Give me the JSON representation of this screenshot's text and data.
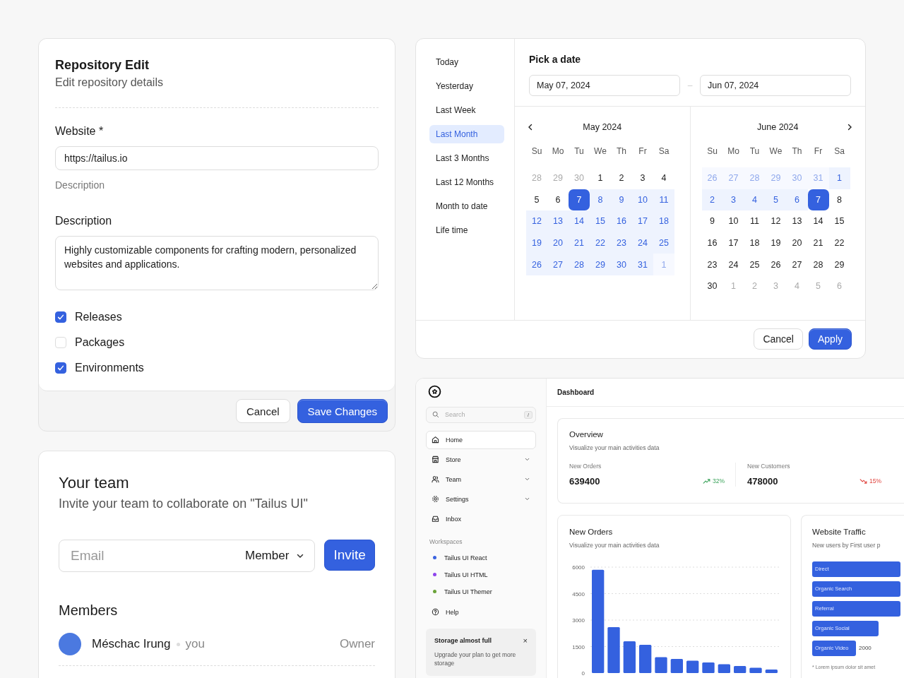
{
  "repository_card": {
    "title": "Repository Edit",
    "subtitle": "Edit repository details",
    "website_label": "Website *",
    "website_value": "https://tailus.io",
    "website_help": "Description",
    "description_label": "Description",
    "description_value": "Highly customizable components for crafting modern, personalized websites and applications.",
    "options": [
      {
        "label": "Releases",
        "checked": true
      },
      {
        "label": "Packages",
        "checked": false
      },
      {
        "label": "Environments",
        "checked": true
      }
    ],
    "buttons": [
      {
        "label": "Cancel",
        "kind": "secondary"
      },
      {
        "label": "Save Changes",
        "kind": "primary"
      }
    ]
  },
  "team_card": {
    "title": "Your team",
    "subtitle": "Invite your team to collaborate on \"Tailus UI\"",
    "email_placeholder": "Email",
    "role": "Member",
    "invite_button": "Invite",
    "members_title": "Members",
    "members": [
      {
        "name": "Méschac Irung",
        "tag": "you",
        "role": "Owner"
      }
    ]
  },
  "date_picker": {
    "presets": [
      {
        "label": "Today",
        "selected": false
      },
      {
        "label": "Yesterday",
        "selected": false
      },
      {
        "label": "Last Week",
        "selected": false
      },
      {
        "label": "Last Month",
        "selected": true
      },
      {
        "label": "Last 3 Months",
        "selected": false
      },
      {
        "label": "Last 12 Months",
        "selected": false
      },
      {
        "label": "Month to date",
        "selected": false
      },
      {
        "label": "Life time",
        "selected": false
      }
    ],
    "title": "Pick a date",
    "start_date": "May 07, 2024",
    "range_separator": "–",
    "end_date": "Jun 07, 2024",
    "months": [
      {
        "title": "May 2024",
        "weekdays": [
          "Su",
          "Mo",
          "Tu",
          "We",
          "Th",
          "Fr",
          "Sa"
        ],
        "days": [
          {
            "n": "28",
            "kind": "outside",
            "in_range": false,
            "selected": false
          },
          {
            "n": "29",
            "kind": "outside",
            "in_range": false,
            "selected": false
          },
          {
            "n": "30",
            "kind": "outside",
            "in_range": false,
            "selected": false
          },
          {
            "n": "1",
            "kind": "day",
            "in_range": false,
            "selected": false
          },
          {
            "n": "2",
            "kind": "day",
            "in_range": false,
            "selected": false
          },
          {
            "n": "3",
            "kind": "day",
            "in_range": false,
            "selected": false
          },
          {
            "n": "4",
            "kind": "day",
            "in_range": false,
            "selected": false
          },
          {
            "n": "5",
            "kind": "day",
            "in_range": false,
            "selected": false
          },
          {
            "n": "6",
            "kind": "day",
            "in_range": false,
            "selected": false
          },
          {
            "n": "7",
            "kind": "day",
            "in_range": true,
            "selected": true
          },
          {
            "n": "8",
            "kind": "day",
            "in_range": true,
            "selected": false
          },
          {
            "n": "9",
            "kind": "day",
            "in_range": true,
            "selected": false
          },
          {
            "n": "10",
            "kind": "day",
            "in_range": true,
            "selected": false
          },
          {
            "n": "11",
            "kind": "day",
            "in_range": true,
            "selected": false
          },
          {
            "n": "12",
            "kind": "day",
            "in_range": true,
            "selected": false
          },
          {
            "n": "13",
            "kind": "day",
            "in_range": true,
            "selected": false
          },
          {
            "n": "14",
            "kind": "day",
            "in_range": true,
            "selected": false
          },
          {
            "n": "15",
            "kind": "day",
            "in_range": true,
            "selected": false
          },
          {
            "n": "16",
            "kind": "day",
            "in_range": true,
            "selected": false
          },
          {
            "n": "17",
            "kind": "day",
            "in_range": true,
            "selected": false
          },
          {
            "n": "18",
            "kind": "day",
            "in_range": true,
            "selected": false
          },
          {
            "n": "19",
            "kind": "day",
            "in_range": true,
            "selected": false
          },
          {
            "n": "20",
            "kind": "day",
            "in_range": true,
            "selected": false
          },
          {
            "n": "21",
            "kind": "day",
            "in_range": true,
            "selected": false
          },
          {
            "n": "22",
            "kind": "day",
            "in_range": true,
            "selected": false
          },
          {
            "n": "23",
            "kind": "day",
            "in_range": true,
            "selected": false
          },
          {
            "n": "24",
            "kind": "day",
            "in_range": true,
            "selected": false
          },
          {
            "n": "25",
            "kind": "day",
            "in_range": true,
            "selected": false
          },
          {
            "n": "26",
            "kind": "day",
            "in_range": true,
            "selected": false
          },
          {
            "n": "27",
            "kind": "day",
            "in_range": true,
            "selected": false
          },
          {
            "n": "28",
            "kind": "day",
            "in_range": true,
            "selected": false
          },
          {
            "n": "29",
            "kind": "day",
            "in_range": true,
            "selected": false
          },
          {
            "n": "30",
            "kind": "day",
            "in_range": true,
            "selected": false
          },
          {
            "n": "31",
            "kind": "day",
            "in_range": true,
            "selected": false
          },
          {
            "n": "1",
            "kind": "outside",
            "in_range": true,
            "selected": false
          }
        ]
      },
      {
        "title": "June 2024",
        "weekdays": [
          "Su",
          "Mo",
          "Tu",
          "We",
          "Th",
          "Fr",
          "Sa"
        ],
        "days": [
          {
            "n": "26",
            "kind": "outside",
            "in_range": true,
            "selected": false
          },
          {
            "n": "27",
            "kind": "outside",
            "in_range": true,
            "selected": false
          },
          {
            "n": "28",
            "kind": "outside",
            "in_range": true,
            "selected": false
          },
          {
            "n": "29",
            "kind": "outside",
            "in_range": true,
            "selected": false
          },
          {
            "n": "30",
            "kind": "outside",
            "in_range": true,
            "selected": false
          },
          {
            "n": "31",
            "kind": "outside",
            "in_range": true,
            "selected": false
          },
          {
            "n": "1",
            "kind": "day",
            "in_range": true,
            "selected": false
          },
          {
            "n": "2",
            "kind": "day",
            "in_range": true,
            "selected": false
          },
          {
            "n": "3",
            "kind": "day",
            "in_range": true,
            "selected": false
          },
          {
            "n": "4",
            "kind": "day",
            "in_range": true,
            "selected": false
          },
          {
            "n": "5",
            "kind": "day",
            "in_range": true,
            "selected": false
          },
          {
            "n": "6",
            "kind": "day",
            "in_range": true,
            "selected": false
          },
          {
            "n": "7",
            "kind": "day",
            "in_range": true,
            "selected": true
          },
          {
            "n": "8",
            "kind": "day",
            "in_range": false,
            "selected": false
          },
          {
            "n": "9",
            "kind": "day",
            "in_range": false,
            "selected": false
          },
          {
            "n": "10",
            "kind": "day",
            "in_range": false,
            "selected": false
          },
          {
            "n": "11",
            "kind": "day",
            "in_range": false,
            "selected": false
          },
          {
            "n": "12",
            "kind": "day",
            "in_range": false,
            "selected": false
          },
          {
            "n": "13",
            "kind": "day",
            "in_range": false,
            "selected": false
          },
          {
            "n": "14",
            "kind": "day",
            "in_range": false,
            "selected": false
          },
          {
            "n": "15",
            "kind": "day",
            "in_range": false,
            "selected": false
          },
          {
            "n": "16",
            "kind": "day",
            "in_range": false,
            "selected": false
          },
          {
            "n": "17",
            "kind": "day",
            "in_range": false,
            "selected": false
          },
          {
            "n": "18",
            "kind": "day",
            "in_range": false,
            "selected": false
          },
          {
            "n": "19",
            "kind": "day",
            "in_range": false,
            "selected": false
          },
          {
            "n": "20",
            "kind": "day",
            "in_range": false,
            "selected": false
          },
          {
            "n": "21",
            "kind": "day",
            "in_range": false,
            "selected": false
          },
          {
            "n": "22",
            "kind": "day",
            "in_range": false,
            "selected": false
          },
          {
            "n": "23",
            "kind": "day",
            "in_range": false,
            "selected": false
          },
          {
            "n": "24",
            "kind": "day",
            "in_range": false,
            "selected": false
          },
          {
            "n": "25",
            "kind": "day",
            "in_range": false,
            "selected": false
          },
          {
            "n": "26",
            "kind": "day",
            "in_range": false,
            "selected": false
          },
          {
            "n": "27",
            "kind": "day",
            "in_range": false,
            "selected": false
          },
          {
            "n": "28",
            "kind": "day",
            "in_range": false,
            "selected": false
          },
          {
            "n": "29",
            "kind": "day",
            "in_range": false,
            "selected": false
          },
          {
            "n": "30",
            "kind": "day",
            "in_range": false,
            "selected": false
          },
          {
            "n": "1",
            "kind": "outside",
            "in_range": false,
            "selected": false
          },
          {
            "n": "2",
            "kind": "outside",
            "in_range": false,
            "selected": false
          },
          {
            "n": "3",
            "kind": "outside",
            "in_range": false,
            "selected": false
          },
          {
            "n": "4",
            "kind": "outside",
            "in_range": false,
            "selected": false
          },
          {
            "n": "5",
            "kind": "outside",
            "in_range": false,
            "selected": false
          },
          {
            "n": "6",
            "kind": "outside",
            "in_range": false,
            "selected": false
          }
        ]
      }
    ],
    "buttons": [
      {
        "label": "Cancel",
        "kind": "secondary"
      },
      {
        "label": "Apply",
        "kind": "primary"
      }
    ]
  },
  "dashboard": {
    "sidebar": {
      "search_placeholder": "Search",
      "search_shortcut": "/",
      "nav": [
        {
          "label": "Home",
          "selected": true,
          "expandable": false
        },
        {
          "label": "Store",
          "selected": false,
          "expandable": true
        },
        {
          "label": "Team",
          "selected": false,
          "expandable": true
        },
        {
          "label": "Settings",
          "selected": false,
          "expandable": true
        },
        {
          "label": "Inbox",
          "selected": false,
          "expandable": false
        }
      ],
      "workspaces_title": "Workspaces",
      "workspaces": [
        {
          "label": "Tailus UI React",
          "color": "#3b63e0"
        },
        {
          "label": "Tailus UI HTML",
          "color": "#8e44ec"
        },
        {
          "label": "Tailus UI Themer",
          "color": "#6aa339"
        }
      ],
      "help": "Help",
      "notice": {
        "title": "Storage almost full",
        "close": "×",
        "text": "Upgrade your plan to get more storage"
      }
    },
    "header": "Dashboard",
    "overview": {
      "title": "Overview",
      "subtitle": "Visualize your main activities data",
      "stats": [
        {
          "label": "New Orders",
          "value": "639400",
          "change": "32%",
          "rising": true
        },
        {
          "label": "New Customers",
          "value": "478000",
          "change": "15%",
          "rising": false
        }
      ]
    },
    "orders_card": {
      "title": "New Orders",
      "subtitle": "Visualize your main activities data",
      "chart_data": {
        "type": "bar",
        "grid": true,
        "values": [
          5850,
          2600,
          1800,
          1600,
          900,
          800,
          700,
          600,
          500,
          400,
          300,
          200
        ],
        "ylim": [
          0,
          6000
        ],
        "yticks": [
          0,
          1500,
          3000,
          4500,
          6000
        ]
      }
    },
    "traffic_card": {
      "title": "Website Traffic",
      "subtitle": "New users by First user p",
      "bars": [
        {
          "label": "Direct"
        },
        {
          "label": "Organic Search"
        },
        {
          "label": "Referral"
        },
        {
          "label": "Organic Social"
        },
        {
          "label": "Organic Video",
          "value": "2000"
        }
      ],
      "footnote": "* Lorem ipsum dolor sit amet"
    }
  }
}
